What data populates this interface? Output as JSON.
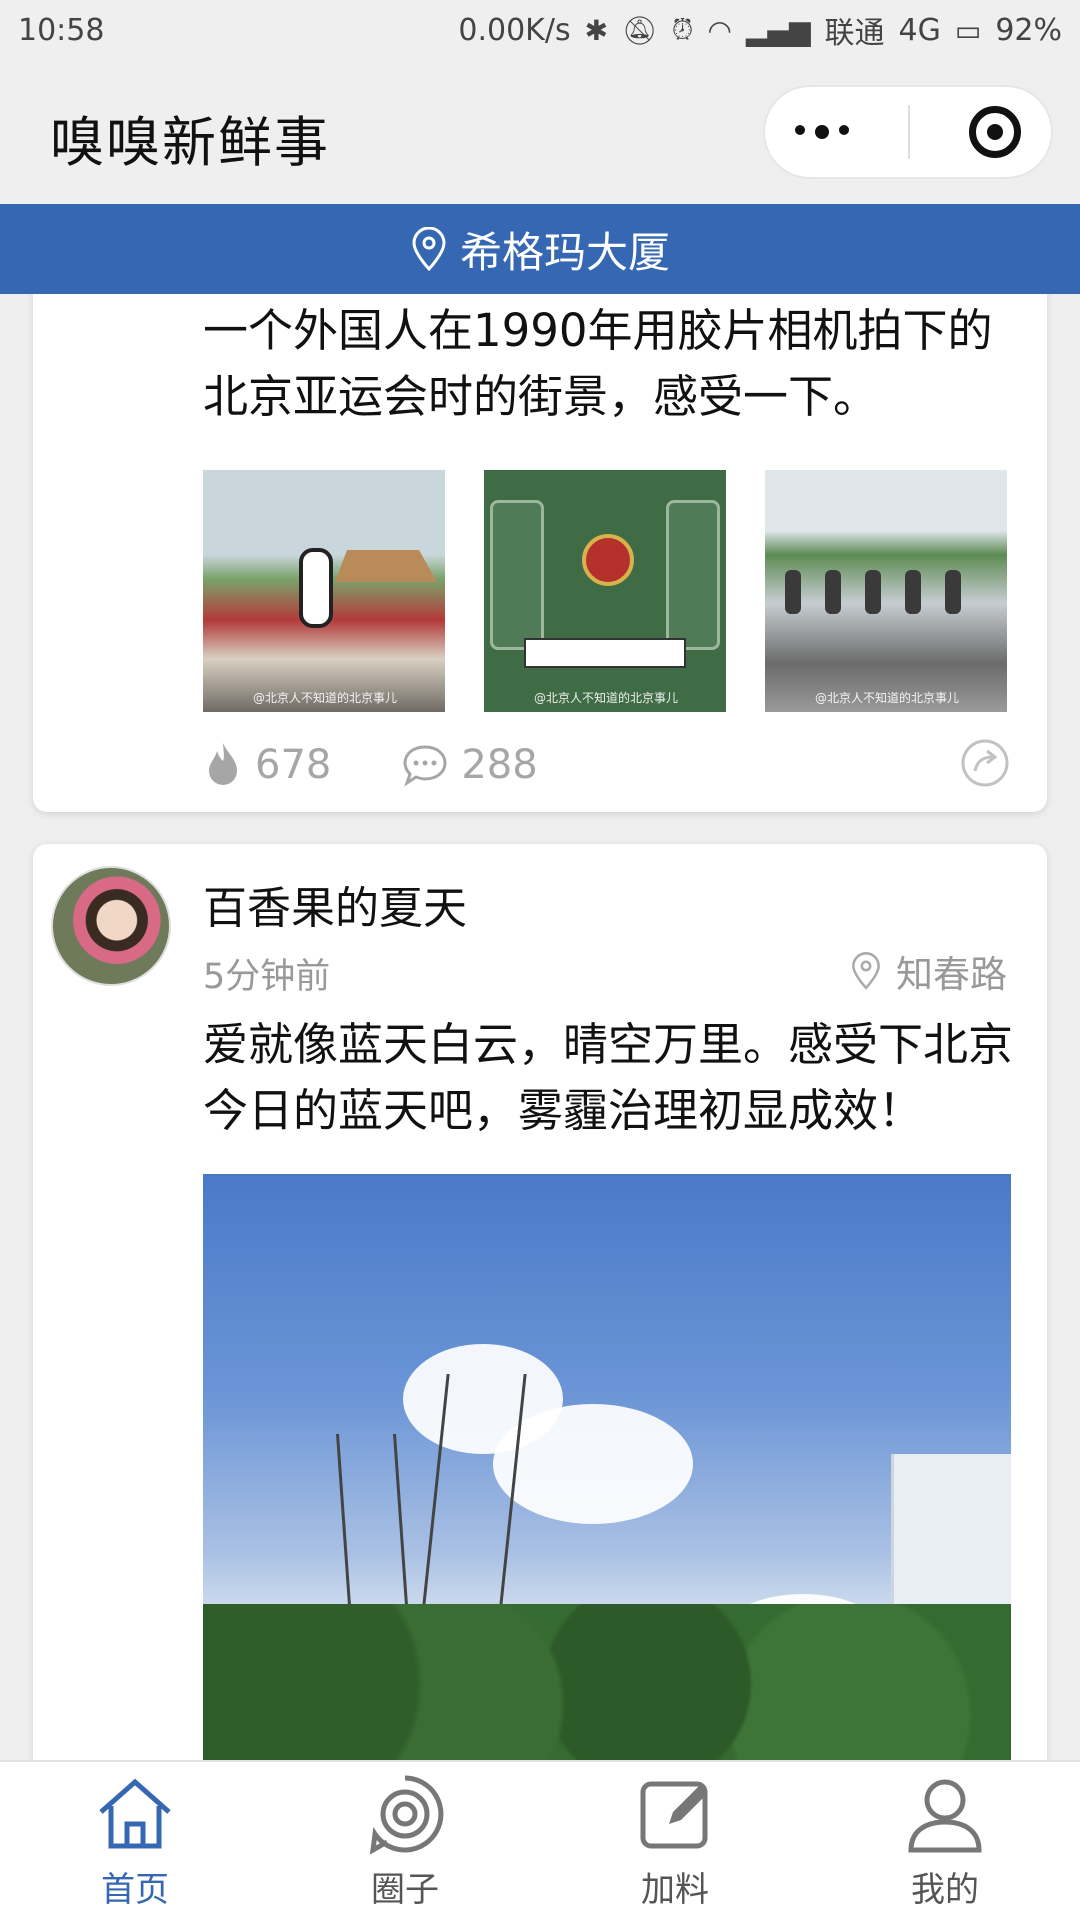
{
  "status": {
    "time": "10:58",
    "net_speed": "0.00K/s",
    "carrier": "联通",
    "network": "4G",
    "battery": "92%"
  },
  "header": {
    "title": "嗅嗅新鲜事"
  },
  "location": {
    "name": "希格玛大厦"
  },
  "posts": [
    {
      "text": "一个外国人在1990年用胶片相机拍下的北京亚运会时的街景，感受一下。",
      "images": [
        {
          "watermark": "@北京人不知道的北京事儿"
        },
        {
          "watermark": "@北京人不知道的北京事儿"
        },
        {
          "watermark": "@北京人不知道的北京事儿"
        }
      ],
      "likes": "678",
      "comments": "288"
    },
    {
      "author": "百香果的夏天",
      "time": "5分钟前",
      "place": "知春路",
      "text": "爱就像蓝天白云，晴空万里。感受下北京今日的蓝天吧，雾霾治理初显成效！"
    }
  ],
  "tabs": [
    {
      "label": "首页",
      "icon": "home-icon",
      "active": true
    },
    {
      "label": "圈子",
      "icon": "circle-icon",
      "active": false
    },
    {
      "label": "加料",
      "icon": "edit-icon",
      "active": false
    },
    {
      "label": "我的",
      "icon": "user-icon",
      "active": false
    }
  ],
  "colors": {
    "accent": "#3567b3",
    "muted": "#a6a6a6",
    "background": "#efefef"
  }
}
